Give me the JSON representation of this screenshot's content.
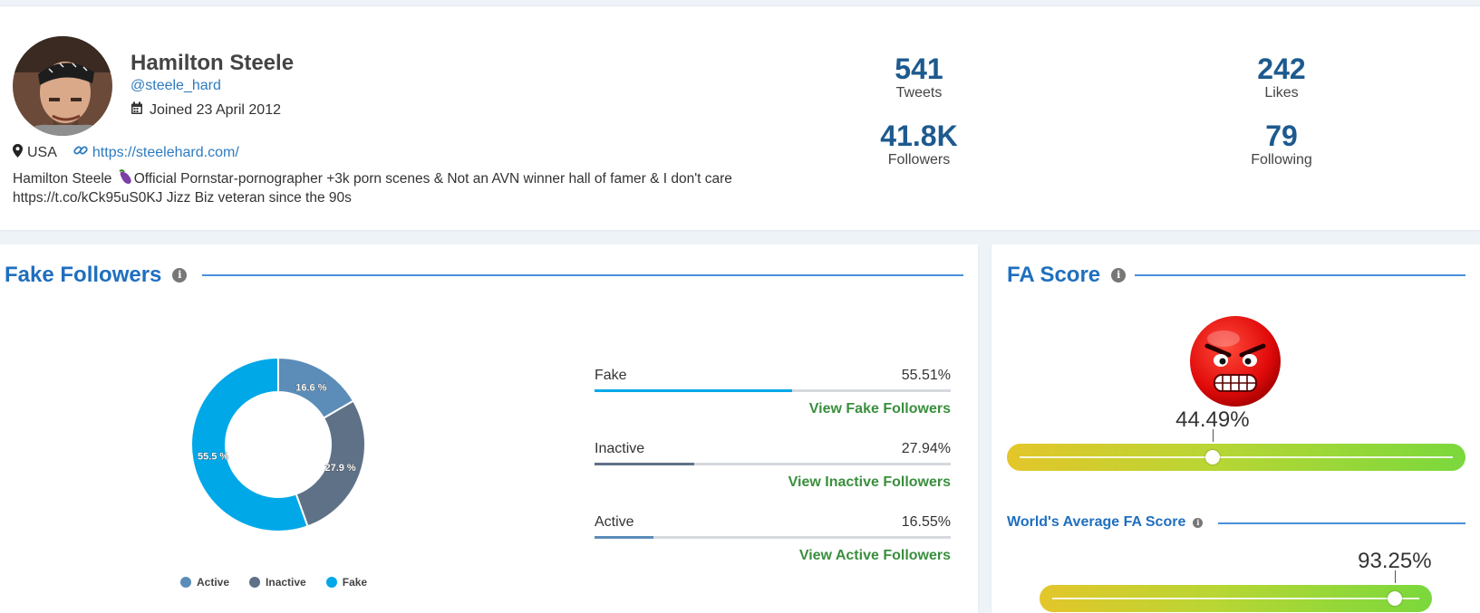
{
  "profile": {
    "name": "Hamilton Steele",
    "handle": "@steele_hard",
    "joined": "Joined 23 April 2012",
    "location": "USA",
    "website": "https://steelehard.com/",
    "bio_prefix": "Hamilton Steele ",
    "bio_text": "Official Pornstar-pornographer +3k porn scenes & Not an AVN winner hall of famer & I don't care https://t.co/kCk95uS0KJ Jizz Biz veteran since the 90s"
  },
  "stats": {
    "tweets": {
      "value": "541",
      "label": "Tweets"
    },
    "likes": {
      "value": "242",
      "label": "Likes"
    },
    "followers": {
      "value": "41.8K",
      "label": "Followers"
    },
    "following": {
      "value": "79",
      "label": "Following"
    }
  },
  "fake_followers": {
    "title": "Fake Followers",
    "bars": [
      {
        "label": "Fake",
        "value": "55.51%",
        "fraction": 0.5551,
        "color": "#00a8e8",
        "link": "View Fake Followers"
      },
      {
        "label": "Inactive",
        "value": "27.94%",
        "fraction": 0.2794,
        "color": "#5f7187",
        "link": "View Inactive Followers"
      },
      {
        "label": "Active",
        "value": "16.55%",
        "fraction": 0.1655,
        "color": "#5b8db8",
        "link": "View Active Followers"
      }
    ]
  },
  "chart_data": {
    "type": "pie",
    "categories": [
      "Active",
      "Inactive",
      "Fake"
    ],
    "values": [
      16.6,
      27.9,
      55.5
    ],
    "data_labels": [
      "16.6 %",
      "27.9 %",
      "55.5 %"
    ],
    "colors": [
      "#5b8db8",
      "#5f7187",
      "#00a8e8"
    ],
    "legend": "bottom",
    "legend_entries": [
      "Active",
      "Inactive",
      "Fake"
    ]
  },
  "fa_score": {
    "title": "FA Score",
    "value": "44.49%",
    "fraction": 0.4449,
    "emoji": "angry-face-icon",
    "world_title": "World's Average FA Score",
    "world_value": "93.25%",
    "world_fraction": 0.9325
  }
}
